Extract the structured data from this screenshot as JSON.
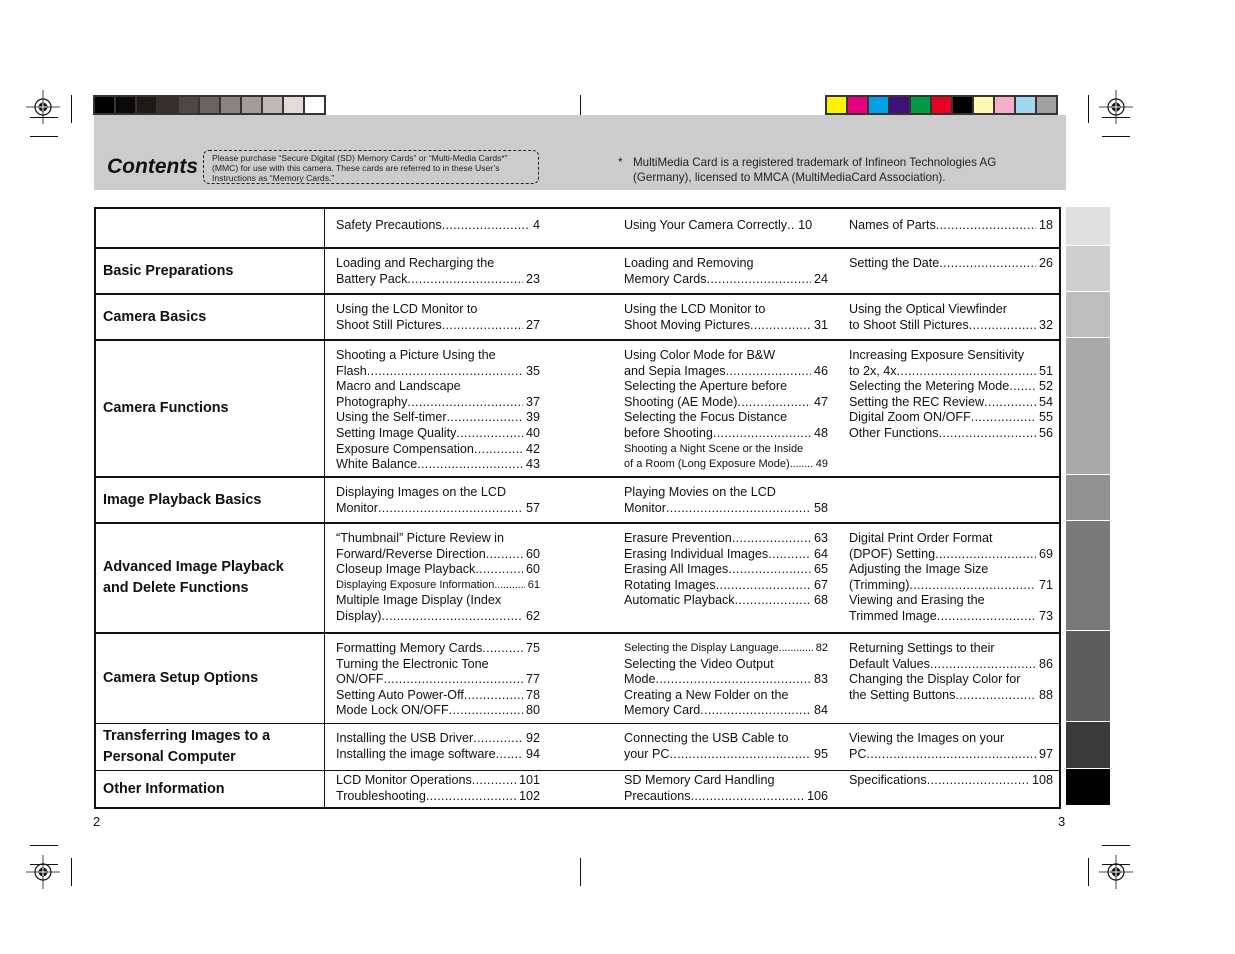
{
  "color_bars": {
    "gray": [
      "#000000",
      "#0a0a0a",
      "#1e1a18",
      "#35302d",
      "#4e4845",
      "#6a6360",
      "#8a8380",
      "#a39d99",
      "#c0b8b4",
      "#e2dcd8",
      "#ffffff"
    ],
    "color": [
      "#fff200",
      "#e4007f",
      "#00a0e9",
      "#3f0f7a",
      "#009a44",
      "#e60021",
      "#000000",
      "#fff9b1",
      "#f5afc8",
      "#a0d8f1",
      "#a0a0a0"
    ]
  },
  "header": {
    "title": "Contents",
    "notice": "Please purchase “Secure Digital (SD) Memory Cards” or “Multi-Media Cards*” (MMC) for use with this camera. These cards are referred to in these User’s Instructions as “Memory Cards.”",
    "footnote_marker": "*",
    "footnote": "MultiMedia Card is a registered trademark of Infineon Technologies AG (Germany), licensed to MMCA (MultiMediaCard Association)."
  },
  "toc": [
    {
      "section": "",
      "columns": [
        [
          {
            "lines": [],
            "last": "Safety Precautions",
            "page": "4"
          }
        ],
        [
          {
            "lines": [],
            "last": "Using Your Camera Correctly",
            "page": "10",
            "dots": "short"
          }
        ],
        [
          {
            "lines": [],
            "last": "Names of Parts",
            "page": "18"
          }
        ]
      ]
    },
    {
      "section": "Basic Preparations",
      "columns": [
        [
          {
            "lines": [
              "Loading and Recharging the"
            ],
            "last": "Battery Pack",
            "page": "23"
          }
        ],
        [
          {
            "lines": [
              "Loading and Removing"
            ],
            "last": "Memory Cards",
            "page": "24"
          }
        ],
        [
          {
            "lines": [],
            "last": "Setting the Date",
            "page": "26"
          }
        ]
      ]
    },
    {
      "section": "Camera Basics",
      "columns": [
        [
          {
            "lines": [
              "Using the LCD Monitor to"
            ],
            "last": "Shoot Still Pictures",
            "page": "27"
          }
        ],
        [
          {
            "lines": [
              "Using the LCD Monitor to"
            ],
            "last": "Shoot Moving Pictures",
            "page": "31"
          }
        ],
        [
          {
            "lines": [
              "Using the Optical Viewfinder"
            ],
            "last": "to Shoot Still Pictures",
            "page": "32"
          }
        ]
      ]
    },
    {
      "section": "Camera Functions",
      "columns": [
        [
          {
            "lines": [
              "Shooting a Picture Using the"
            ],
            "last": "Flash",
            "page": "35"
          },
          {
            "lines": [
              "Macro and Landscape"
            ],
            "last": "Photography",
            "page": "37"
          },
          {
            "lines": [],
            "last": "Using the Self-timer",
            "page": "39"
          },
          {
            "lines": [],
            "last": "Setting Image Quality",
            "page": "40"
          },
          {
            "lines": [],
            "last": "Exposure Compensation",
            "page": "42"
          },
          {
            "lines": [],
            "last": "White Balance",
            "page": "43"
          }
        ],
        [
          {
            "lines": [
              "Using Color Mode for B&W"
            ],
            "last": "and Sepia Images",
            "page": "46"
          },
          {
            "lines": [
              "Selecting the Aperture before"
            ],
            "last": "Shooting (AE Mode)",
            "page": "47"
          },
          {
            "lines": [
              "Selecting the Focus Distance"
            ],
            "last": "before Shooting",
            "page": "48"
          },
          {
            "lines": [
              "Shooting a Night Scene or the Inside"
            ],
            "last": "of a Room (Long Exposure Mode)",
            "page": "49",
            "small": true
          }
        ],
        [
          {
            "lines": [
              "Increasing Exposure Sensitivity"
            ],
            "last": "to 2x, 4x",
            "page": "51"
          },
          {
            "lines": [],
            "last": "Selecting the Metering Mode",
            "page": "52"
          },
          {
            "lines": [],
            "last": "Setting the REC Review",
            "page": "54"
          },
          {
            "lines": [],
            "last": "Digital Zoom ON/OFF",
            "page": "55"
          },
          {
            "lines": [],
            "last": "Other Functions",
            "page": "56"
          }
        ]
      ]
    },
    {
      "section": "Image Playback Basics",
      "columns": [
        [
          {
            "lines": [
              "Displaying Images on the LCD"
            ],
            "last": "Monitor",
            "page": "57"
          }
        ],
        [
          {
            "lines": [
              "Playing Movies on the LCD"
            ],
            "last": "Monitor",
            "page": "58"
          }
        ],
        []
      ]
    },
    {
      "section": "Advanced Image Playback and Delete Functions",
      "columns": [
        [
          {
            "lines": [
              "“Thumbnail” Picture Review in"
            ],
            "last": "Forward/Reverse Direction",
            "page": "60"
          },
          {
            "lines": [],
            "last": "Closeup Image Playback",
            "page": "60"
          },
          {
            "lines": [],
            "last": "Displaying Exposure Information",
            "page": "61",
            "small": true
          },
          {
            "lines": [
              "Multiple Image Display (Index"
            ],
            "last": "Display)",
            "page": "62"
          }
        ],
        [
          {
            "lines": [],
            "last": "Erasure Prevention",
            "page": "63"
          },
          {
            "lines": [],
            "last": "Erasing Individual Images",
            "page": "64"
          },
          {
            "lines": [],
            "last": "Erasing All Images",
            "page": "65"
          },
          {
            "lines": [],
            "last": "Rotating Images",
            "page": "67"
          },
          {
            "lines": [],
            "last": "Automatic Playback",
            "page": "68"
          }
        ],
        [
          {
            "lines": [
              "Digital Print Order Format"
            ],
            "last": "(DPOF) Setting",
            "page": "69"
          },
          {
            "lines": [
              "Adjusting the Image Size"
            ],
            "last": "(Trimming)",
            "page": "71"
          },
          {
            "lines": [
              "Viewing and Erasing the"
            ],
            "last": "Trimmed Image",
            "page": "73"
          }
        ]
      ]
    },
    {
      "section": "Camera Setup Options",
      "columns": [
        [
          {
            "lines": [],
            "last": "Formatting Memory Cards",
            "page": "75"
          },
          {
            "lines": [
              "Turning the Electronic Tone"
            ],
            "last": "ON/OFF",
            "page": "77"
          },
          {
            "lines": [],
            "last": "Setting Auto Power-Off",
            "page": "78"
          },
          {
            "lines": [],
            "last": "Mode Lock ON/OFF",
            "page": "80"
          }
        ],
        [
          {
            "lines": [],
            "last": "Selecting the Display Language",
            "page": "82",
            "small": true
          },
          {
            "lines": [
              "Selecting the Video Output"
            ],
            "last": "Mode",
            "page": "83"
          },
          {
            "lines": [
              "Creating a New Folder on the"
            ],
            "last": "Memory Card",
            "page": "84"
          }
        ],
        [
          {
            "lines": [
              "Returning Settings to their"
            ],
            "last": "Default Values",
            "page": "86"
          },
          {
            "lines": [
              "Changing the Display Color for"
            ],
            "last": "the Setting Buttons",
            "page": "88"
          }
        ]
      ]
    },
    {
      "section": "Transferring Images to a Personal Computer",
      "columns": [
        [
          {
            "lines": [],
            "last": "Installing the USB Driver",
            "page": "92"
          },
          {
            "lines": [],
            "last": "Installing the image software",
            "page": "94"
          }
        ],
        [
          {
            "lines": [
              "Connecting the USB Cable to"
            ],
            "last": "your PC",
            "page": "95"
          }
        ],
        [
          {
            "lines": [
              "Viewing the Images on your"
            ],
            "last": "PC",
            "page": "97"
          }
        ]
      ]
    },
    {
      "section": "Other Information",
      "columns": [
        [
          {
            "lines": [],
            "last": "LCD Monitor Operations",
            "page": "101"
          },
          {
            "lines": [],
            "last": "Troubleshooting",
            "page": "102"
          }
        ],
        [
          {
            "lines": [
              "SD Memory Card Handling"
            ],
            "last": "Precautions",
            "page": "106"
          }
        ],
        [
          {
            "lines": [],
            "last": "Specifications",
            "page": "108"
          }
        ]
      ]
    }
  ],
  "side_tabs": [
    "#e0e0e0",
    "#cfcfcf",
    "#bdbdbd",
    "#a9a9a9",
    "#919191",
    "#797979",
    "#5d5d5d",
    "#3a3a3a",
    "#000000"
  ],
  "page_numbers": {
    "left": "2",
    "right": "3"
  }
}
